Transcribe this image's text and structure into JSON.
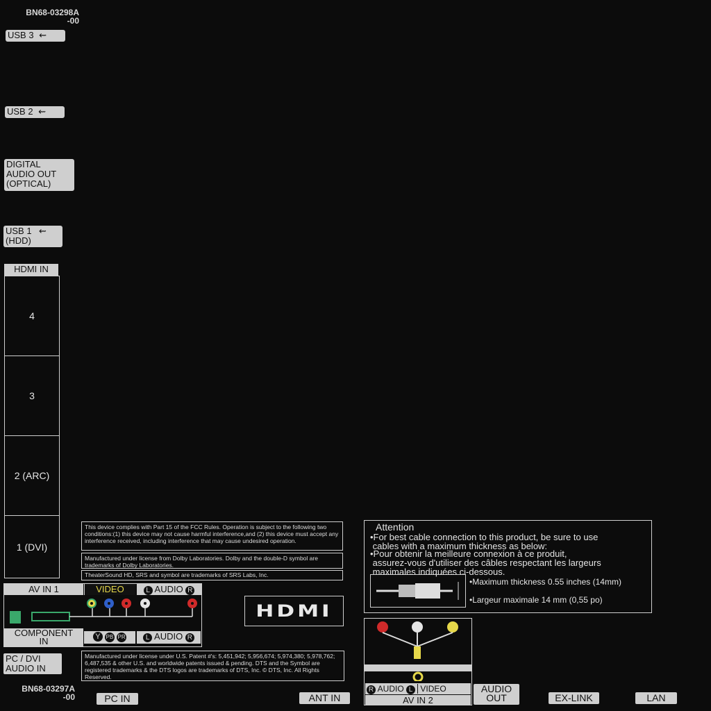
{
  "part_numbers": {
    "top": "BN68-03298A\n-00",
    "bottom": "BN68-03297A\n-00"
  },
  "left_ports": {
    "usb3": "USB 3",
    "usb2": "USB 2",
    "digital_audio_out": "DIGITAL\nAUDIO OUT\n(OPTICAL)",
    "usb1": "USB 1\n(HDD)",
    "usb_symbol": "usb-icon"
  },
  "hdmi_in": {
    "header": "HDMI IN",
    "ports": [
      "4",
      "3",
      "2 (ARC)",
      "1 (DVI)"
    ]
  },
  "fcc_notice": {
    "fcc": "This device complies with Part 15 of the FCC Rules. Operation is subject to the following two conditions:(1) this device may not cause harmful interference,and (2) this device must accept any interference received, including interference that may cause undesired operation.",
    "dolby": "Manufactured under license from Dolby Laboratories. Dolby and the double-D symbol are trademarks of Dolby Laboratories.",
    "srs": "TheaterSound HD, SRS and  symbol are trademarks of SRS Labs, Inc."
  },
  "av_in_1": {
    "title": "AV IN 1",
    "video": "VIDEO",
    "audio": "AUDIO",
    "audio_l": "L",
    "audio_r": "R",
    "component": "COMPONENT\nIN",
    "y": "Y",
    "pb": "PB",
    "pr": "PR",
    "audio2": "AUDIO",
    "colors": {
      "green": "#3aa86b",
      "blue": "#2f5fc9",
      "red": "#d02a2a",
      "white": "#e4e4e4",
      "yellow": "#e6d84a"
    }
  },
  "hdmi_logo": "HDMI",
  "dts_notice": "Manufactured under license under U.S. Patent #'s: 5,451,942; 5,956,674; 5,974,380; 5,978,762; 6,487,535 & other U.S. and worldwide patents issued & pending. DTS and the Symbol are registered trademarks & the DTS logos are trademarks of DTS, Inc. © DTS, Inc. All Rights Reserved.",
  "pc_dvi_audio_in": "PC / DVI\nAUDIO IN",
  "attention": {
    "title": "Attention",
    "line1": "•For best cable connection to this product, be sure to use\n cables with a maximum thickness as below:",
    "line2": "•Pour obtenir la meilleure connexion à ce produit,\n assurez-vous d'utiliser des câbles respectant les largeurs\n maximales indiquées ci-dessous.",
    "max_en": "•Maximum thickness 0.55 inches (14mm)",
    "max_fr": "•Largeur maximale 14 mm (0,55 po)"
  },
  "av_in_2": {
    "title": "AV IN 2",
    "audio": "AUDIO",
    "r": "R",
    "l": "L",
    "video": "VIDEO"
  },
  "bottom_ports": {
    "pc_in": "PC IN",
    "ant_in": "ANT IN",
    "audio_out": "AUDIO\nOUT",
    "ex_link": "EX-LINK",
    "lan": "LAN"
  }
}
